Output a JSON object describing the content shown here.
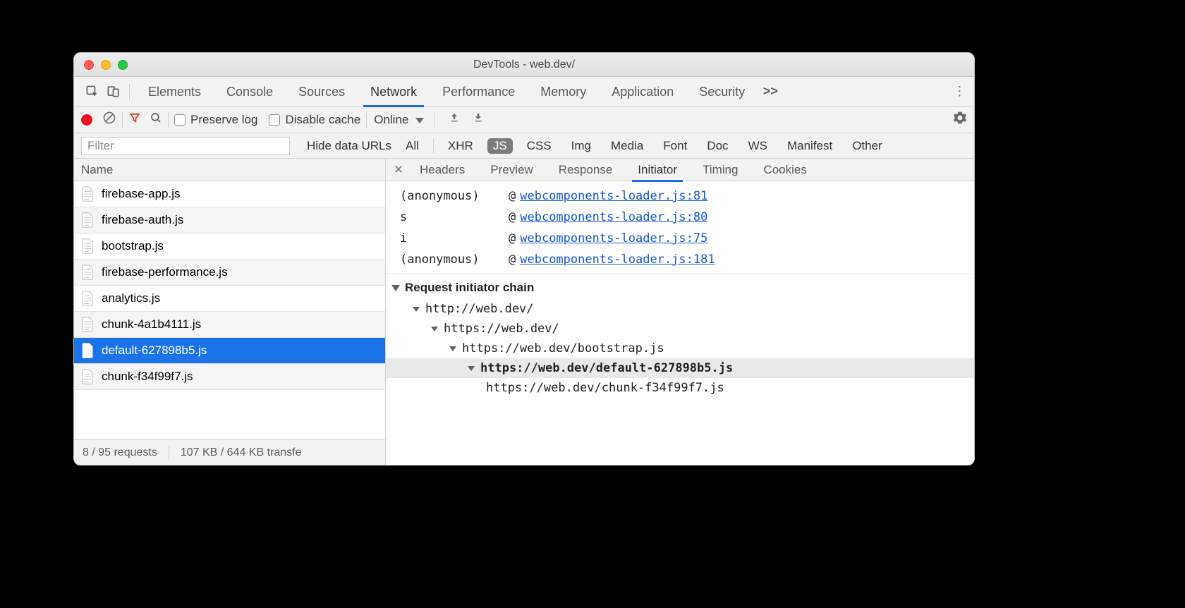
{
  "window": {
    "title": "DevTools - web.dev/"
  },
  "tabs": {
    "items": [
      "Elements",
      "Console",
      "Sources",
      "Network",
      "Performance",
      "Memory",
      "Application",
      "Security"
    ],
    "active": "Network",
    "overflow": ">>"
  },
  "toolbar": {
    "preserve_log": "Preserve log",
    "disable_cache": "Disable cache",
    "throttle": "Online"
  },
  "filterbar": {
    "placeholder": "Filter",
    "hide_data_urls": "Hide data URLs",
    "types": [
      "All",
      "XHR",
      "JS",
      "CSS",
      "Img",
      "Media",
      "Font",
      "Doc",
      "WS",
      "Manifest",
      "Other"
    ],
    "selected": "JS"
  },
  "request_list": {
    "header": "Name",
    "items": [
      {
        "name": "firebase-app.js"
      },
      {
        "name": "firebase-auth.js"
      },
      {
        "name": "bootstrap.js"
      },
      {
        "name": "firebase-performance.js"
      },
      {
        "name": "analytics.js"
      },
      {
        "name": "chunk-4a1b4111.js"
      },
      {
        "name": "default-627898b5.js",
        "selected": true
      },
      {
        "name": "chunk-f34f99f7.js"
      }
    ],
    "status": {
      "requests": "8 / 95 requests",
      "transfer": "107 KB / 644 KB transfe"
    }
  },
  "detail_tabs": {
    "items": [
      "Headers",
      "Preview",
      "Response",
      "Initiator",
      "Timing",
      "Cookies"
    ],
    "active": "Initiator"
  },
  "initiator": {
    "stack": [
      {
        "fn": "(anonymous)",
        "at": "@",
        "link": "webcomponents-loader.js:81"
      },
      {
        "fn": "s",
        "at": "@",
        "link": "webcomponents-loader.js:80"
      },
      {
        "fn": "i",
        "at": "@",
        "link": "webcomponents-loader.js:75"
      },
      {
        "fn": "(anonymous)",
        "at": "@",
        "link": "webcomponents-loader.js:181"
      }
    ],
    "chain_title": "Request initiator chain",
    "chain": [
      {
        "depth": 0,
        "url": "http://web.dev/"
      },
      {
        "depth": 1,
        "url": "https://web.dev/"
      },
      {
        "depth": 2,
        "url": "https://web.dev/bootstrap.js"
      },
      {
        "depth": 3,
        "url": "https://web.dev/default-627898b5.js",
        "current": true
      },
      {
        "depth": 4,
        "url": "https://web.dev/chunk-f34f99f7.js",
        "leaf": true
      }
    ]
  }
}
